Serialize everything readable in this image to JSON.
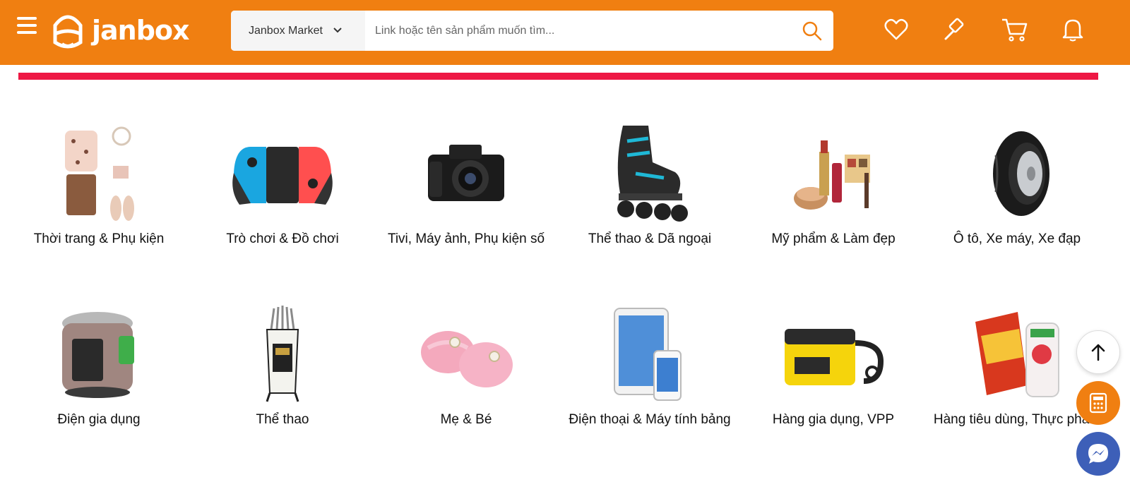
{
  "header": {
    "logo_text": "janbox",
    "market_label": "Janbox Market",
    "search_placeholder": "Link hoặc tên sản phẩm muốn tìm..."
  },
  "categories": [
    {
      "label": "Thời trang & Phụ kiện"
    },
    {
      "label": "Trò chơi & Đồ chơi"
    },
    {
      "label": "Tivi, Máy ảnh, Phụ kiện số"
    },
    {
      "label": "Thể thao & Dã ngoại"
    },
    {
      "label": "Mỹ phẩm & Làm đẹp"
    },
    {
      "label": "Ô tô, Xe máy, Xe đạp"
    },
    {
      "label": "Điện gia dụng"
    },
    {
      "label": "Thể thao"
    },
    {
      "label": "Mẹ & Bé"
    },
    {
      "label": "Điện thoại & Máy tính bảng"
    },
    {
      "label": "Hàng gia dụng, VPP"
    },
    {
      "label": "Hàng tiêu dùng, Thực phẩm"
    }
  ],
  "colors": {
    "brand_orange": "#f07f11",
    "accent_red": "#ee1844",
    "messenger_blue": "#3d5fb8"
  }
}
